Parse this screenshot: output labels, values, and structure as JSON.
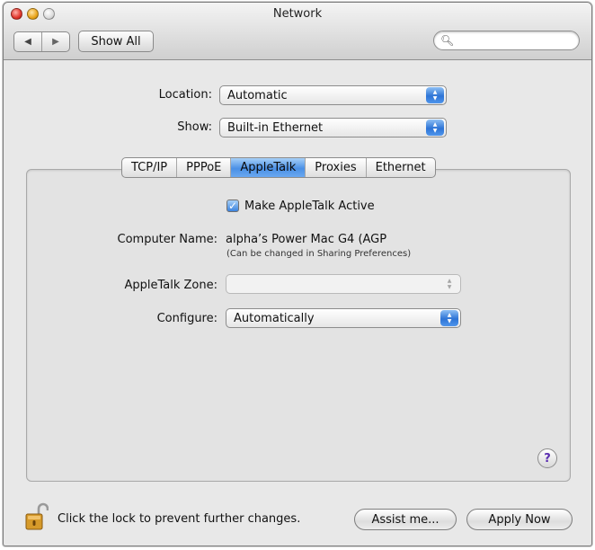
{
  "window": {
    "title": "Network"
  },
  "toolbar": {
    "back_icon": "back-arrow-icon",
    "forward_icon": "forward-arrow-icon",
    "show_all_label": "Show All",
    "search": {
      "value": "",
      "placeholder": ""
    }
  },
  "location": {
    "label": "Location:",
    "value": "Automatic"
  },
  "show": {
    "label": "Show:",
    "value": "Built-in Ethernet"
  },
  "tabs": [
    {
      "label": "TCP/IP"
    },
    {
      "label": "PPPoE"
    },
    {
      "label": "AppleTalk",
      "active": true
    },
    {
      "label": "Proxies"
    },
    {
      "label": "Ethernet"
    }
  ],
  "appletalk": {
    "make_active_label": "Make AppleTalk Active",
    "make_active_checked": true,
    "computer_name_label": "Computer Name:",
    "computer_name_value": "alpha’s Power Mac G4 (AGP",
    "computer_name_note": "(Can be changed in Sharing Preferences)",
    "zone_label": "AppleTalk Zone:",
    "zone_value": "",
    "configure_label": "Configure:",
    "configure_value": "Automatically"
  },
  "footer": {
    "lock_text": "Click the lock to prevent further changes.",
    "assist_label": "Assist me...",
    "apply_label": "Apply Now"
  },
  "colors": {
    "accent": "#3b83df",
    "help": "#5a2db0"
  }
}
